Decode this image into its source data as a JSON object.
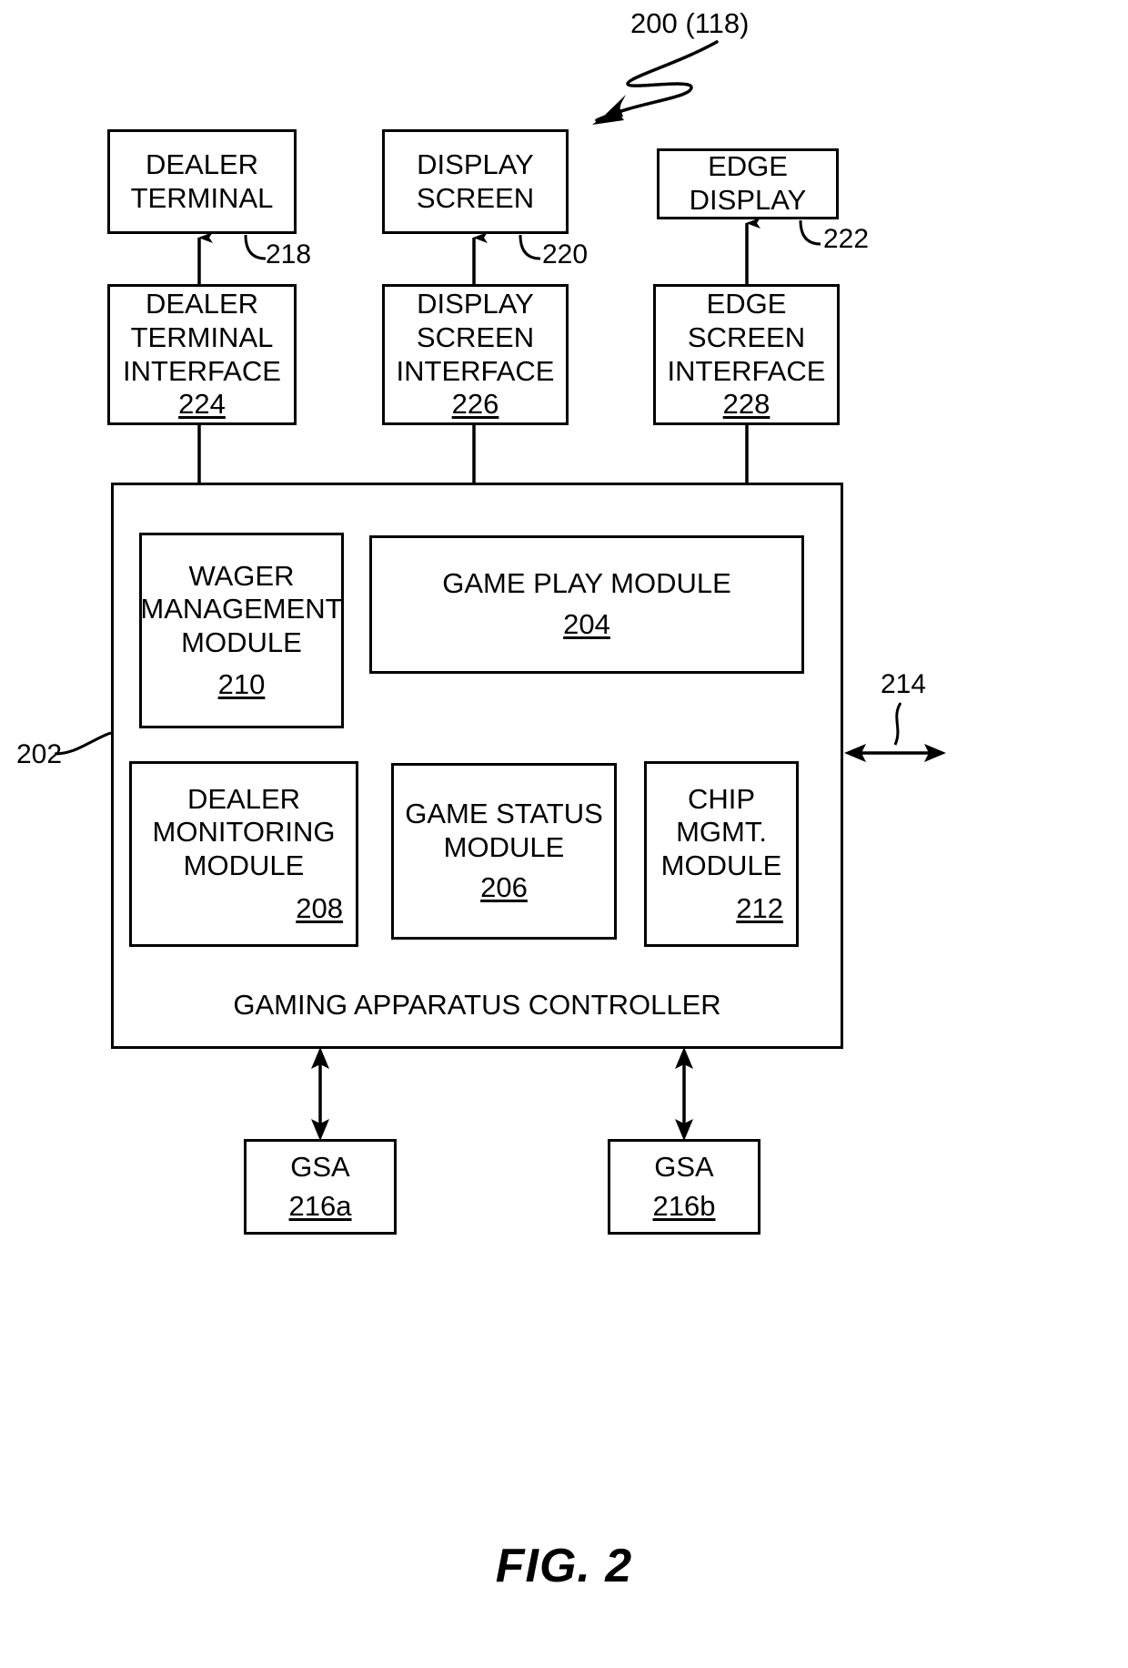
{
  "figure": {
    "label": "FIG. 2",
    "system_ref": "200 (118)"
  },
  "devices": [
    {
      "name": "dealer-terminal",
      "lines": [
        "DEALER",
        "TERMINAL"
      ],
      "ref": "218"
    },
    {
      "name": "display-screen",
      "lines": [
        "DISPLAY",
        "SCREEN"
      ],
      "ref": "220"
    },
    {
      "name": "edge-display",
      "lines": [
        "EDGE",
        "DISPLAY"
      ],
      "ref": "222"
    }
  ],
  "interfaces": [
    {
      "name": "dealer-terminal-interface",
      "lines": [
        "DEALER",
        "TERMINAL",
        "INTERFACE"
      ],
      "ref": "224"
    },
    {
      "name": "display-screen-interface",
      "lines": [
        "DISPLAY",
        "SCREEN",
        "INTERFACE"
      ],
      "ref": "226"
    },
    {
      "name": "edge-screen-interface",
      "lines": [
        "EDGE",
        "SCREEN",
        "INTERFACE"
      ],
      "ref": "228"
    }
  ],
  "controller": {
    "title": "GAMING APPARATUS CONTROLLER",
    "ref": "202",
    "external_port_ref": "214",
    "modules": [
      {
        "name": "wager-management-module",
        "lines": [
          "WAGER",
          "MANAGEMENT",
          "MODULE"
        ],
        "ref": "210",
        "ref_align": "center"
      },
      {
        "name": "game-play-module",
        "lines": [
          "GAME PLAY MODULE"
        ],
        "ref": "204",
        "ref_align": "center"
      },
      {
        "name": "dealer-monitoring-module",
        "lines": [
          "DEALER",
          "MONITORING",
          "MODULE"
        ],
        "ref": "208",
        "ref_align": "right"
      },
      {
        "name": "game-status-module",
        "lines": [
          "GAME STATUS",
          "MODULE"
        ],
        "ref": "206",
        "ref_align": "center"
      },
      {
        "name": "chip-management-module",
        "lines": [
          "CHIP",
          "MGMT.",
          "MODULE"
        ],
        "ref": "212",
        "ref_align": "right"
      }
    ]
  },
  "gsa_units": [
    {
      "name": "gsa-a",
      "label": "GSA",
      "ref": "216a"
    },
    {
      "name": "gsa-b",
      "label": "GSA",
      "ref": "216b"
    }
  ]
}
